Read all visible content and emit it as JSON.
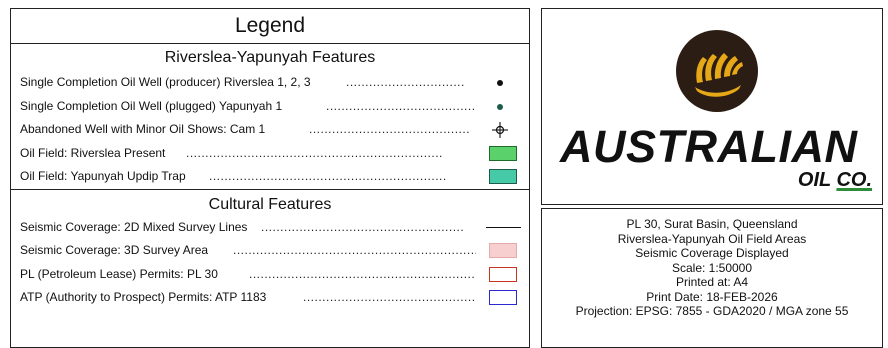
{
  "legend": {
    "title": "Legend",
    "section1": {
      "title": "Riverslea-Yapunyah Features",
      "rows": [
        {
          "label": "Single Completion Oil Well (producer)  Riverslea 1, 2, 3",
          "dots": "...............................",
          "symbol": "black-dot-icon",
          "color": "#111111"
        },
        {
          "label": "Single Completion Oil Well (plugged)  Yapunyah 1",
          "dots": ".......................................",
          "symbol": "teal-dot-icon",
          "color": "#1d5c4a"
        },
        {
          "label": "Abandoned Well with Minor Oil Shows: Cam 1",
          "dots": "..........................................",
          "symbol": "abandoned-well-icon",
          "color": "#111111"
        },
        {
          "label": "Oil Field: Riverslea Present",
          "dots": "...................................................................",
          "symbol": "green-swatch",
          "color": "#5ad16a"
        },
        {
          "label": "Oil Field: Yapunyah Updip Trap",
          "dots": "..............................................................",
          "symbol": "teal-swatch",
          "color": "#46c9a6"
        }
      ]
    },
    "section2": {
      "title": "Cultural Features",
      "rows": [
        {
          "label": "Seismic Coverage: 2D Mixed Survey Lines",
          "dots": ".....................................................",
          "symbol": "line",
          "color": "#111111"
        },
        {
          "label": "Seismic Coverage: 3D Survey Area",
          "dots": "................................................................",
          "symbol": "pink-swatch",
          "color": "#f7cfcf"
        },
        {
          "label": "PL (Petroleum Lease) Permits: PL 30",
          "dots": "............................................................",
          "symbol": "red-outline-swatch",
          "color": "#c8361f"
        },
        {
          "label": "ATP (Authority to Prospect) Permits: ATP 1183",
          "dots": "...............................................",
          "symbol": "blue-outline-swatch",
          "color": "#2a2ad0"
        }
      ]
    }
  },
  "company": {
    "name": "AUSTRALIAN",
    "sub_oil": "OIL",
    "sub_co": "CO.",
    "logo_colors": {
      "circle": "#2b1d13",
      "stripes": "#e6a817",
      "accent": "#2e8b3a"
    }
  },
  "info": {
    "lines": [
      "PL 30, Surat Basin, Queensland",
      "Riverslea-Yapunyah Oil Field Areas",
      "Seismic Coverage Displayed",
      "Scale: 1:50000",
      "Printed at: A4",
      "Print Date: 18-FEB-2026",
      "Projection: EPSG: 7855 - GDA2020 / MGA zone 55"
    ]
  }
}
